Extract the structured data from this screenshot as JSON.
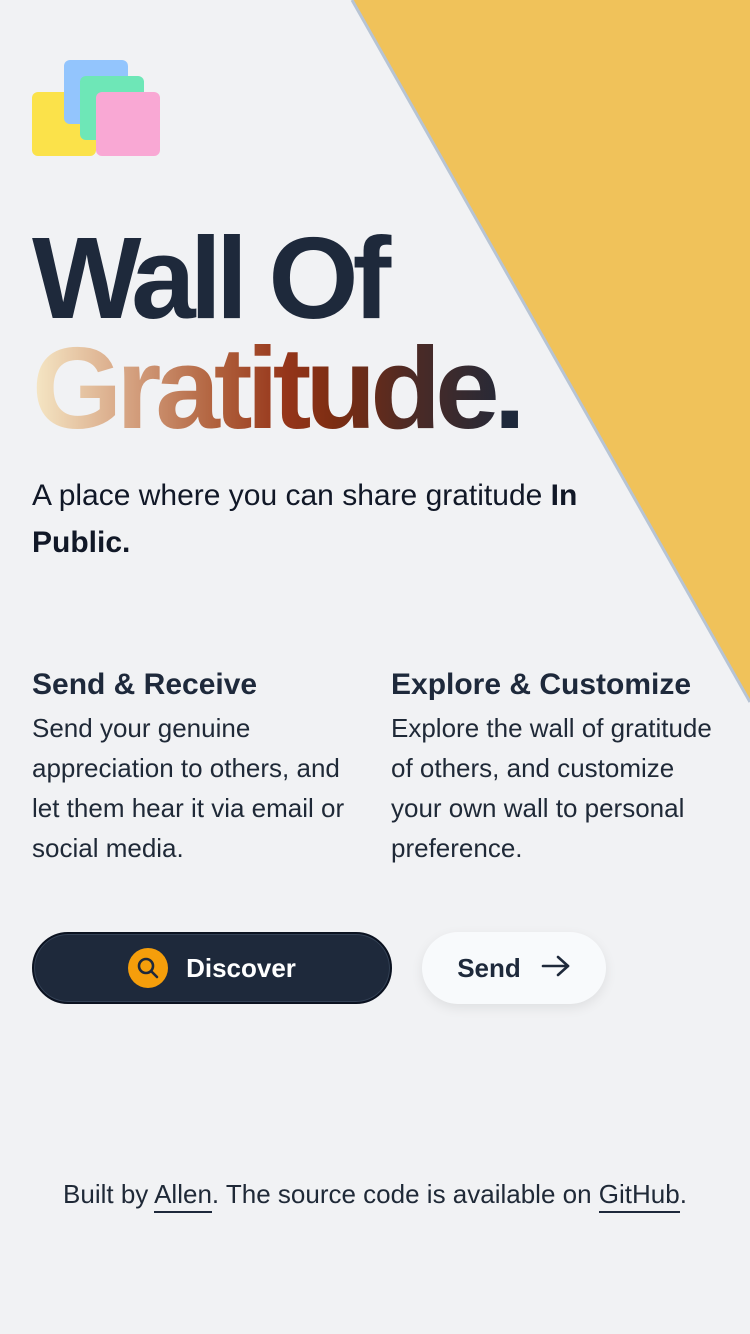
{
  "colors": {
    "background": "#f1f2f4",
    "accent_triangle": "#f0c25a",
    "title_dark": "#1e293b",
    "discover_button": "#1e293b",
    "discover_icon_bg": "#f59e0b"
  },
  "logo": {
    "icon": "stacked-squares-logo-icon"
  },
  "hero": {
    "title_line1": "Wall Of",
    "title_line2": "Gratitude",
    "title_period": ".",
    "tagline_text": "A place where you can share gratitude ",
    "tagline_bold": "In Public."
  },
  "features": [
    {
      "title": "Send & Receive",
      "description": "Send your genuine appreciation to others, and let them hear it via email or social media."
    },
    {
      "title": "Explore & Customize",
      "description": "Explore the wall of gratitude of others, and customize your own wall to personal preference."
    }
  ],
  "actions": {
    "discover_label": "Discover",
    "discover_icon": "search-icon",
    "send_label": "Send",
    "send_icon": "arrow-right-icon"
  },
  "footer": {
    "prefix": "Built by ",
    "author_link": "Allen",
    "middle": ". The source code is available on ",
    "github_link": "GitHub",
    "suffix": "."
  }
}
